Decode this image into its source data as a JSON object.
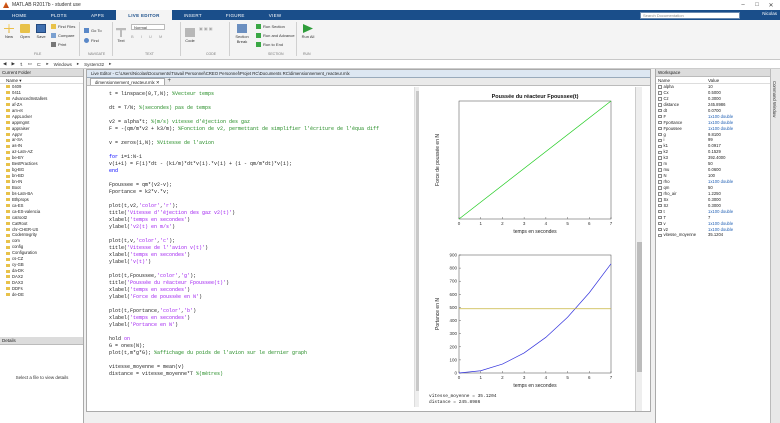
{
  "window": {
    "title": "MATLAB R2017b - student use"
  },
  "menubar": {
    "tabs": [
      "HOME",
      "PLOTS",
      "APPS",
      "LIVE EDITOR",
      "INSERT",
      "FIGURE",
      "VIEW"
    ],
    "search_placeholder": "Search Documentation",
    "user": "Nicolas"
  },
  "ribbon": {
    "new": "New",
    "open": "Open",
    "save": "Save",
    "find_files": "Find Files",
    "compare": "Compare",
    "print": "Print",
    "go_to": "Go To",
    "find": "Find",
    "text": "Text",
    "style": "Normal",
    "code": "Code",
    "run_section": "Run Section",
    "run_and_advance": "Run and Advance",
    "run_to_end": "Run to End",
    "section_break": "Section Break",
    "run": "Run All",
    "groups": [
      "FILE",
      "NAVIGATE",
      "TEXT",
      "CODE",
      "SECTION",
      "RUN"
    ]
  },
  "address": {
    "path": [
      "C:",
      "Windows",
      "System32"
    ]
  },
  "current_folder": {
    "title": "Current Folder",
    "column": "Name",
    "items": [
      "0409",
      "0411",
      "AdvancedInstallers",
      "af-ZA",
      "am-et",
      "AppLocker",
      "appmgmt",
      "appraiser",
      "AppV",
      "ar-SA",
      "as-IN",
      "az-Latn-AZ",
      "be-BY",
      "BestPractices",
      "bg-BG",
      "bn-BD",
      "bn-IN",
      "Boot",
      "bs-Latn-BA",
      "Bthprops",
      "ca-ES",
      "ca-ES-valencia",
      "catroot2",
      "CatRoot",
      "chr-CHER-US",
      "CodeIntegrity",
      "com",
      "config",
      "Configuration",
      "cs-CZ",
      "cy-GB",
      "da-DK",
      "DAX2",
      "DAX3",
      "DDFs",
      "de-DE"
    ]
  },
  "details": {
    "title": "Details",
    "message": "Select a file to view details"
  },
  "editor": {
    "title": "Live Editor - C:\\Users\\Nicolas\\Documents\\Travail Personnel\\CREO Personnel\\Projet RC\\Documents RC\\dimensionnement_reacteur.mlx",
    "file_tab": "dimensionnement_reacteur.mlx",
    "output": [
      "vitesse_moyenne = 35.1204",
      "distance = 245.8986"
    ]
  },
  "chart_data": [
    {
      "type": "line",
      "title": "Poussée du réacteur Fpoussee(t)",
      "xlabel": "temps en secondes",
      "ylabel": "Force de poussée en N",
      "xlim": [
        0,
        7
      ],
      "xticks": [
        0,
        1,
        2,
        3,
        4,
        5,
        6,
        7
      ],
      "series": [
        {
          "x": [
            0,
            7
          ],
          "y": [
            0,
            7000
          ],
          "color": "#22cc22"
        }
      ]
    },
    {
      "type": "line",
      "title": "",
      "xlabel": "temps en secondes",
      "ylabel": "Portance en N",
      "xlim": [
        0,
        7
      ],
      "ylim": [
        0,
        900
      ],
      "xticks": [
        0,
        1,
        2,
        3,
        4,
        5,
        6,
        7
      ],
      "yticks": [
        0,
        100,
        200,
        300,
        400,
        500,
        600,
        700,
        800,
        900
      ],
      "series": [
        {
          "x": [
            0,
            1,
            2,
            3,
            4,
            5,
            6,
            7
          ],
          "y": [
            0,
            17,
            68,
            153,
            272,
            425,
            612,
            833
          ],
          "color": "#3333dd"
        },
        {
          "x": [
            0,
            7
          ],
          "y": [
            490,
            490
          ],
          "color": "#c8b43c"
        }
      ]
    }
  ],
  "workspace": {
    "title": "Workspace",
    "cols": [
      "Name",
      "Value"
    ],
    "rows": [
      [
        "alpha",
        "10"
      ],
      [
        "Cx",
        "0.5000"
      ],
      [
        "Cz",
        "0.3000"
      ],
      [
        "distance",
        "245.8986"
      ],
      [
        "dt",
        "0.0700"
      ],
      [
        "F",
        "1x100 double"
      ],
      [
        "Fportance",
        "1x100 double"
      ],
      [
        "Fpoussee",
        "1x100 double"
      ],
      [
        "g",
        "9.8100"
      ],
      [
        "i",
        "99"
      ],
      [
        "k1",
        "0.0917"
      ],
      [
        "k2",
        "0.1529"
      ],
      [
        "k3",
        "392.4000"
      ],
      [
        "m",
        "50"
      ],
      [
        "mu",
        "0.0600"
      ],
      [
        "N",
        "100"
      ],
      [
        "rho",
        "1x100 double"
      ],
      [
        "qm",
        "50"
      ],
      [
        "rho_air",
        "1.2250"
      ],
      [
        "Sx",
        "0.3000"
      ],
      [
        "Sz",
        "0.3000"
      ],
      [
        "t",
        "1x100 double"
      ],
      [
        "T",
        "7"
      ],
      [
        "v",
        "1x100 double"
      ],
      [
        "v2",
        "1x100 double"
      ],
      [
        "vitesse_moyenne",
        "35.1204"
      ]
    ]
  },
  "command_window": {
    "title": "Command Window"
  }
}
